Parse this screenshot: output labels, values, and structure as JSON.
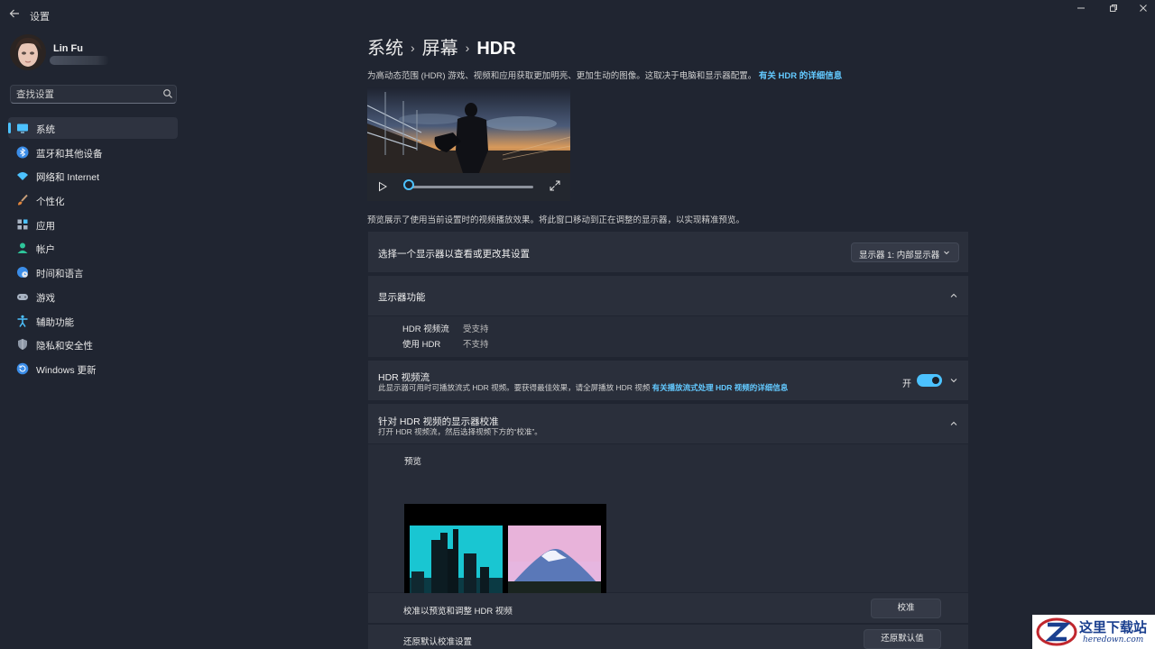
{
  "window": {
    "title": "设置",
    "back_icon": "arrow-left-icon"
  },
  "user": {
    "name": "Lin Fu"
  },
  "search": {
    "placeholder": "查找设置"
  },
  "sidebar": {
    "items": [
      {
        "label": "系统",
        "icon": "monitor-icon",
        "active": true
      },
      {
        "label": "蓝牙和其他设备",
        "icon": "bluetooth-icon"
      },
      {
        "label": "网络和 Internet",
        "icon": "wifi-icon"
      },
      {
        "label": "个性化",
        "icon": "brush-icon"
      },
      {
        "label": "应用",
        "icon": "apps-icon"
      },
      {
        "label": "帐户",
        "icon": "person-icon"
      },
      {
        "label": "时间和语言",
        "icon": "globe-clock-icon"
      },
      {
        "label": "游戏",
        "icon": "gamepad-icon"
      },
      {
        "label": "辅助功能",
        "icon": "accessibility-icon"
      },
      {
        "label": "隐私和安全性",
        "icon": "shield-icon"
      },
      {
        "label": "Windows 更新",
        "icon": "update-icon"
      }
    ]
  },
  "breadcrumb": {
    "level1": "系统",
    "level2": "屏幕",
    "current": "HDR"
  },
  "intro": {
    "text": "为高动态范围 (HDR) 游戏、视频和应用获取更加明亮、更加生动的图像。这取决于电脑和显示器配置。",
    "link": "有关 HDR 的详细信息"
  },
  "video": {
    "progress": 0.0
  },
  "preview_note": "预览展示了使用当前设置时的视频播放效果。将此窗口移动到正在调整的显示器，以实现精准预览。",
  "display_select": {
    "label": "选择一个显示器以查看或更改其设置",
    "value": "显示器 1: 内部显示器"
  },
  "capabilities": {
    "title": "显示器功能",
    "rows": [
      {
        "key": "HDR 视频流",
        "value": "受支持"
      },
      {
        "key": "使用 HDR",
        "value": "不支持"
      }
    ]
  },
  "hdr_stream": {
    "title": "HDR 视频流",
    "desc": "此显示器可用时可播放流式 HDR 视频。要获得最佳效果，请全屏播放 HDR 视频",
    "link": "有关播放流式处理 HDR 视频的详细信息",
    "toggle_label": "开",
    "toggle_on": true
  },
  "calibration": {
    "title": "针对 HDR 视频的显示器校准",
    "desc": "打开 HDR 视频流，然后选择视频下方的“校准”。",
    "preview_label": "预览",
    "calibrate_label": "校准以预览和调整 HDR 视频",
    "calibrate_button": "校准",
    "reset_label": "还原默认校准设置",
    "reset_button": "还原默认值"
  },
  "watermark": {
    "text": "这里下载站",
    "sub": "heredown.com"
  },
  "colors": {
    "accent": "#4cc2ff",
    "background": "#202531",
    "card": "#2a2f3b"
  }
}
